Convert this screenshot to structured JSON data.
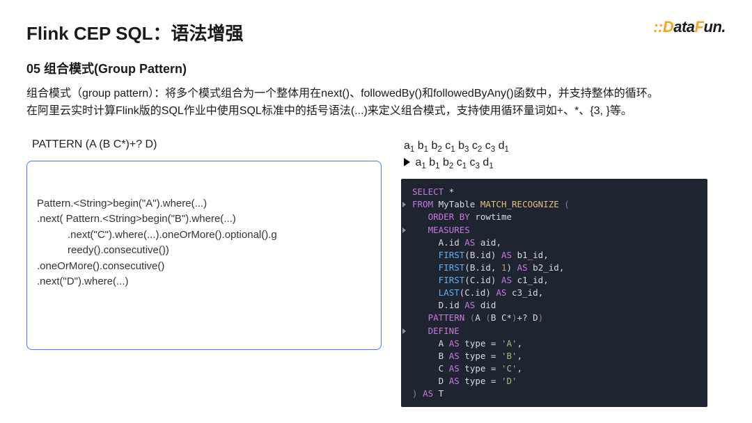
{
  "title": "Flink CEP SQL：语法增强",
  "logo": {
    "part1": "::",
    "part2": "D",
    "part3": "ata",
    "part4": "F",
    "part5": "un."
  },
  "subtitle": "05 组合模式(Group Pattern)",
  "description": "组合模式（group pattern）：将多个模式组合为一个整体用在next()、followedBy()和followedByAny()函数中，并支持整体的循环。\n在阿里云实时计算Flink版的SQL作业中使用SQL标准中的括号语法(...)来定义组合模式，支持使用循环量词如+、*、{3, }等。",
  "patternLabel": "PATTERN (A (B C*)+? D)",
  "javaCode": {
    "l1": "Pattern.<String>begin(\"A\").where(...)",
    "l2": ".next( Pattern.<String>begin(\"B\").where(...)",
    "l3a": ".next(\"C\").where(...).oneOrMore().optional().g",
    "l3b": "reedy().consecutive())",
    "l4": ".oneOrMore().consecutive()",
    "l5": ".next(\"D\").where(...)"
  },
  "sequence": {
    "line1": "a_1 b_1 b_2 c_1 b_3 c_2 c_3 d_1",
    "line2": "→ a_1 b_1 b_2 c_1 c_3 d_1"
  },
  "sql": {
    "lines": [
      {
        "gutter": false,
        "html": "<span class='kw'>SELECT</span> <span class='id'>*</span>"
      },
      {
        "gutter": true,
        "html": "<span class='kw'>FROM</span> <span class='id'>MyTable</span> <span class='fn'>MATCH_RECOGNIZE</span> <span class='paren'>(</span>"
      },
      {
        "gutter": false,
        "html": "   <span class='kw'>ORDER BY</span> <span class='id'>rowtime</span>"
      },
      {
        "gutter": true,
        "html": "   <span class='kw'>MEASURES</span>"
      },
      {
        "gutter": false,
        "html": "     <span class='id'>A.id</span> <span class='kw'>AS</span> <span class='id'>aid</span>,"
      },
      {
        "gutter": false,
        "html": "     <span class='func'>FIRST</span>(<span class='id'>B.id</span>) <span class='kw'>AS</span> <span class='id'>b1_id</span>,"
      },
      {
        "gutter": false,
        "html": "     <span class='func'>FIRST</span>(<span class='id'>B.id</span>, <span class='num'>1</span>) <span class='kw'>AS</span> <span class='id'>b2_id</span>,"
      },
      {
        "gutter": false,
        "html": "     <span class='func'>FIRST</span>(<span class='id'>C.id</span>) <span class='kw'>AS</span> <span class='id'>c1_id</span>,"
      },
      {
        "gutter": false,
        "html": "     <span class='func'>LAST</span>(<span class='id'>C.id</span>) <span class='kw'>AS</span> <span class='id'>c3_id</span>,"
      },
      {
        "gutter": false,
        "html": "     <span class='id'>D.id</span> <span class='kw'>AS</span> <span class='id'>did</span>"
      },
      {
        "gutter": false,
        "html": "   <span class='kw'>PATTERN</span> <span class='paren'>(</span><span class='id'>A </span><span class='paren'>(</span><span class='id'>B C*</span><span class='paren'>)</span><span class='id'>+? D</span><span class='paren'>)</span>"
      },
      {
        "gutter": true,
        "html": "   <span class='kw'>DEFINE</span>"
      },
      {
        "gutter": false,
        "html": "     <span class='id'>A</span> <span class='kw'>AS</span> <span class='id'>type</span> = <span class='str'>'A'</span>,"
      },
      {
        "gutter": false,
        "html": "     <span class='id'>B</span> <span class='kw'>AS</span> <span class='id'>type</span> = <span class='str'>'B'</span>,"
      },
      {
        "gutter": false,
        "html": "     <span class='id'>C</span> <span class='kw'>AS</span> <span class='id'>type</span> = <span class='str'>'C'</span>,"
      },
      {
        "gutter": false,
        "html": "     <span class='id'>D</span> <span class='kw'>AS</span> <span class='id'>type</span> = <span class='str'>'D'</span>"
      },
      {
        "gutter": false,
        "html": "<span class='paren'>)</span> <span class='kw'>AS</span> <span class='id'>T</span>"
      }
    ]
  }
}
